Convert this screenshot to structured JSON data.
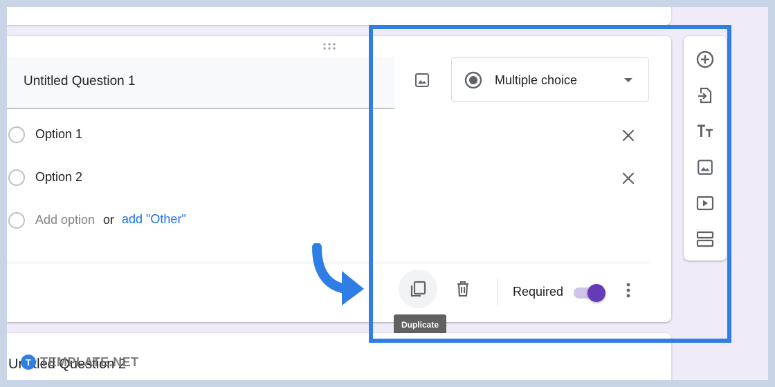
{
  "question": {
    "title": "Untitled Question 1",
    "type_label": "Multiple choice",
    "options": [
      {
        "label": "Option 1"
      },
      {
        "label": "Option 2"
      }
    ],
    "add_option": "Add option",
    "or_text": "or",
    "add_other": "add \"Other\""
  },
  "footer": {
    "required_label": "Required",
    "required_on": true,
    "duplicate_tooltip": "Duplicate"
  },
  "sidebar": {
    "tools": [
      {
        "icon": "add-circle-icon"
      },
      {
        "icon": "import-questions-icon"
      },
      {
        "icon": "title-text-icon"
      },
      {
        "icon": "image-icon"
      },
      {
        "icon": "video-icon"
      },
      {
        "icon": "section-icon"
      }
    ]
  },
  "next_question": {
    "title": "Untitled Question 2"
  },
  "watermark": {
    "logo_letter": "T",
    "text": "TEMPLATE.NET"
  },
  "colors": {
    "accent": "#673ab7",
    "accent_track": "#d1c4e9",
    "link": "#1a73e8",
    "annotation": "#2f7ee6",
    "background": "#f0ebf8"
  }
}
